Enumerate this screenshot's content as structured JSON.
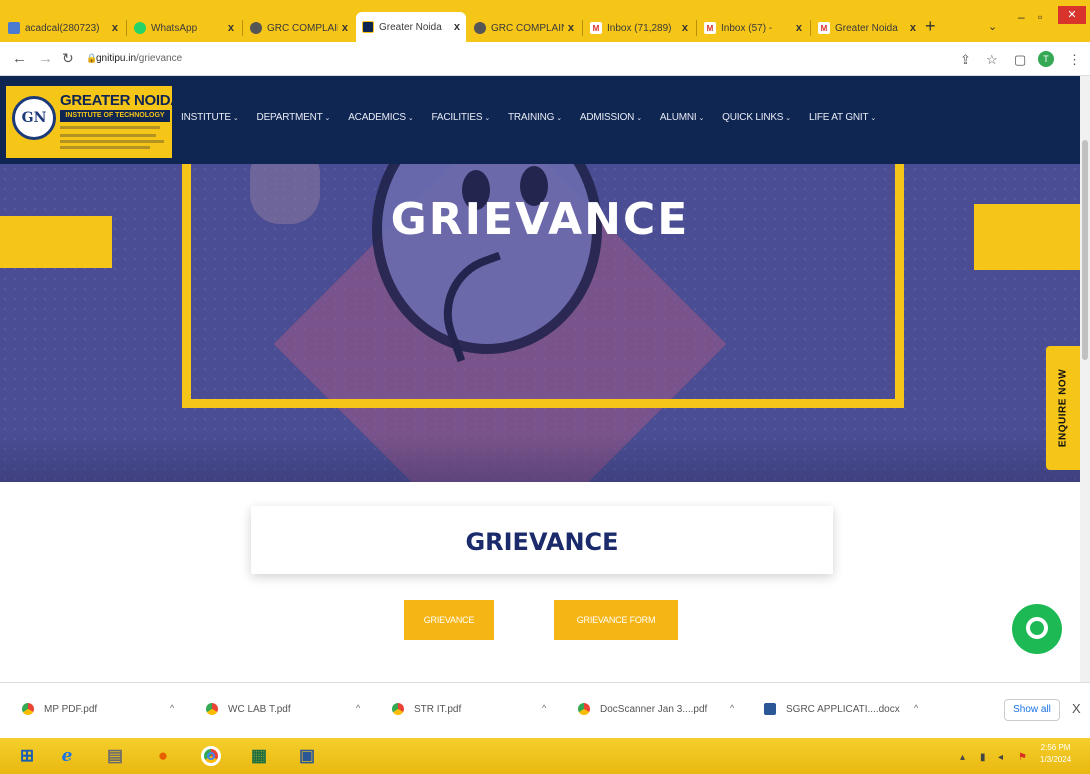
{
  "browser": {
    "tabs": [
      {
        "label": "acadcal(280723)",
        "icon": "tab-doc-icon",
        "active": false
      },
      {
        "label": "WhatsApp",
        "icon": "whatsapp-icon",
        "active": false
      },
      {
        "label": "GRC COMPLAINT",
        "icon": "globe-icon",
        "active": false
      },
      {
        "label": "Greater Noida",
        "icon": "site-favicon",
        "active": true
      },
      {
        "label": "GRC COMPLAINT",
        "icon": "globe-icon",
        "active": false
      },
      {
        "label": "Inbox (71,289)",
        "icon": "gmail-icon",
        "active": false
      },
      {
        "label": "Inbox (57) -",
        "icon": "gmail-icon",
        "active": false
      },
      {
        "label": "Greater Noida",
        "icon": "gmail-icon",
        "active": false
      }
    ],
    "new_tab": "+",
    "tab_menu": "⌄",
    "close_glyph": "x",
    "url_host": "gnitipu.in",
    "url_path": "/grievance"
  },
  "site": {
    "logo": {
      "line1": "GREATER NOIDA",
      "line2": "INSTITUTE OF TECHNOLOGY",
      "monogram": "GN"
    },
    "nav": [
      {
        "label": "INSTITUTE",
        "caret": "⌄"
      },
      {
        "label": "DEPARTMENT",
        "caret": "⌄"
      },
      {
        "label": "ACADEMICS",
        "caret": "⌄"
      },
      {
        "label": "FACILITIES",
        "caret": "⌄"
      },
      {
        "label": "TRAINING",
        "caret": "⌄"
      },
      {
        "label": "ADMISSION",
        "caret": "⌄"
      },
      {
        "label": "ALUMNI",
        "caret": "⌄"
      },
      {
        "label": "QUICK LINKS",
        "caret": "⌄"
      },
      {
        "label": "LIFE AT GNIT",
        "caret": "⌄"
      }
    ],
    "hero_title": "GRIEVANCE",
    "enquire_label": "ENQUIRE NOW",
    "section_title": "GRIEVANCE",
    "buttons": {
      "grievance": "GRIEVANCE",
      "grievance_form": "GRIEVANCE FORM"
    }
  },
  "downloads": {
    "items": [
      {
        "name": "MP PDF.pdf",
        "icon": "chrome-icon"
      },
      {
        "name": "WC LAB T.pdf",
        "icon": "chrome-icon"
      },
      {
        "name": "STR IT.pdf",
        "icon": "chrome-icon"
      },
      {
        "name": "DocScanner Jan 3....pdf",
        "icon": "chrome-icon"
      },
      {
        "name": "SGRC APPLICATI....docx",
        "icon": "word-doc-icon"
      }
    ],
    "caret": "^",
    "show_all": "Show all",
    "close": "X"
  },
  "taskbar": {
    "time": "2:56 PM",
    "date": "1/3/2024"
  },
  "colors": {
    "brand_navy": "#0f2552",
    "brand_yellow": "#f5c518",
    "hero_purple": "#4a4d93",
    "button_orange": "#f5b515",
    "chat_green": "#1db954",
    "title_navy": "#1b2a6b"
  }
}
